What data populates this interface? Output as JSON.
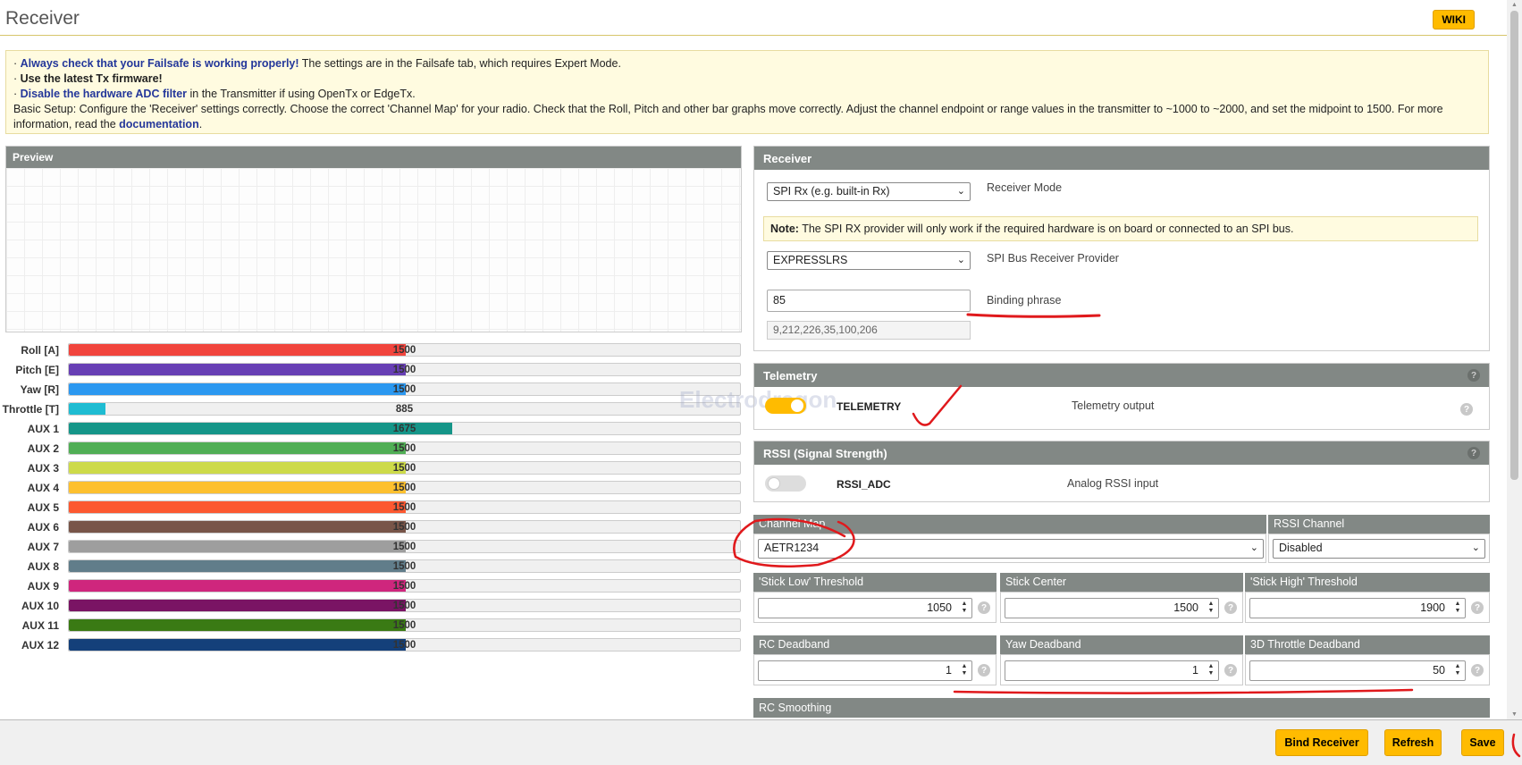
{
  "header": {
    "title": "Receiver",
    "wiki_label": "WIKI"
  },
  "notice": {
    "line1_link": "Always check that your Failsafe is working properly!",
    "line1_rest": " The settings are in the Failsafe tab, which requires Expert Mode.",
    "line2": "Use the latest Tx firmware!",
    "line3_link": "Disable the hardware ADC filter",
    "line3_rest": " in the Transmitter if using OpenTx or EdgeTx.",
    "line4": "Basic Setup: Configure the 'Receiver' settings correctly. Choose the correct 'Channel Map' for your radio. Check that the Roll, Pitch and other bar graphs move correctly. Adjust the channel endpoint or range values in the transmitter to ~1000 to ~2000, and set the midpoint to 1500. For more information, read the ",
    "line4_link": "documentation",
    "line4_end": "."
  },
  "preview": {
    "title": "Preview"
  },
  "channels": [
    {
      "label": "Roll [A]",
      "value": "1500",
      "level": 0.5,
      "color": "#f1453d"
    },
    {
      "label": "Pitch [E]",
      "value": "1500",
      "level": 0.5,
      "color": "#673fb4"
    },
    {
      "label": "Yaw [R]",
      "value": "1500",
      "level": 0.5,
      "color": "#2b98f0"
    },
    {
      "label": "Throttle [T]",
      "value": "885",
      "level": 0.055,
      "color": "#1fbcd2"
    },
    {
      "label": "AUX 1",
      "value": "1675",
      "level": 0.57,
      "color": "#159588"
    },
    {
      "label": "AUX 2",
      "value": "1500",
      "level": 0.5,
      "color": "#50ae55"
    },
    {
      "label": "AUX 3",
      "value": "1500",
      "level": 0.5,
      "color": "#cdda49"
    },
    {
      "label": "AUX 4",
      "value": "1500",
      "level": 0.5,
      "color": "#fdc02f"
    },
    {
      "label": "AUX 5",
      "value": "1500",
      "level": 0.5,
      "color": "#fc5830"
    },
    {
      "label": "AUX 6",
      "value": "1500",
      "level": 0.5,
      "color": "#785549"
    },
    {
      "label": "AUX 7",
      "value": "1500",
      "level": 0.5,
      "color": "#9e9e9e"
    },
    {
      "label": "AUX 8",
      "value": "1500",
      "level": 0.5,
      "color": "#617d8a"
    },
    {
      "label": "AUX 9",
      "value": "1500",
      "level": 0.5,
      "color": "#cf267d"
    },
    {
      "label": "AUX 10",
      "value": "1500",
      "level": 0.5,
      "color": "#7a1464"
    },
    {
      "label": "AUX 11",
      "value": "1500",
      "level": 0.5,
      "color": "#3a7a14"
    },
    {
      "label": "AUX 12",
      "value": "1500",
      "level": 0.5,
      "color": "#14407a"
    }
  ],
  "receiver": {
    "title": "Receiver",
    "mode_value": "SPI Rx (e.g. built-in Rx)",
    "mode_label": "Receiver Mode",
    "note_bold": "Note:",
    "note_text": " The SPI RX provider will only work if the required hardware is on board or connected to an SPI bus.",
    "provider_value": "EXPRESSLRS",
    "provider_label": "SPI Bus Receiver Provider",
    "binding_value": "85",
    "binding_label": "Binding phrase",
    "uid_value": "9,212,226,35,100,206"
  },
  "telemetry": {
    "title": "Telemetry",
    "toggle_name": "TELEMETRY",
    "toggle_desc": "Telemetry output",
    "enabled": true
  },
  "rssi": {
    "title": "RSSI (Signal Strength)",
    "toggle_name": "RSSI_ADC",
    "toggle_desc": "Analog RSSI input",
    "enabled": false
  },
  "channel_map": {
    "label": "Channel Map",
    "value": "AETR1234"
  },
  "rssi_channel": {
    "label": "RSSI Channel",
    "value": "Disabled"
  },
  "thresholds": [
    {
      "label": "'Stick Low' Threshold",
      "value": "1050"
    },
    {
      "label": "Stick Center",
      "value": "1500"
    },
    {
      "label": "'Stick High' Threshold",
      "value": "1900"
    }
  ],
  "deadbands": [
    {
      "label": "RC Deadband",
      "value": "1"
    },
    {
      "label": "Yaw Deadband",
      "value": "1"
    },
    {
      "label": "3D Throttle Deadband",
      "value": "50"
    }
  ],
  "rc_smoothing": {
    "title": "RC Smoothing"
  },
  "footer": {
    "bind_label": "Bind Receiver",
    "refresh_label": "Refresh",
    "save_label": "Save"
  },
  "watermark": "Electrodragon"
}
